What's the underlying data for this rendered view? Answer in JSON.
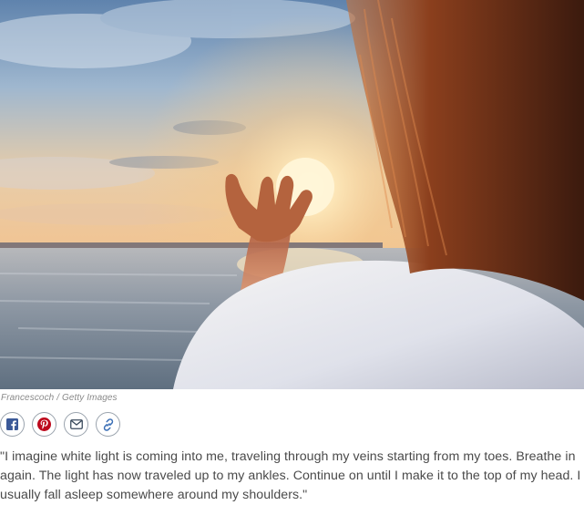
{
  "photo": {
    "credit": "Francescoch / Getty Images",
    "colors": {
      "sky_top": "#5f83ad",
      "sky_glow": "#f6d7a7",
      "sun": "#fff3cf",
      "sea": "#7d8b9c",
      "hair": "#5a2a16",
      "shirt": "#e9eaf0"
    }
  },
  "share": {
    "buttons": [
      {
        "icon": "facebook-icon"
      },
      {
        "icon": "pinterest-icon"
      },
      {
        "icon": "email-icon"
      },
      {
        "icon": "link-icon"
      }
    ],
    "colors": {
      "facebook": "#3b5998",
      "pinterest": "#bd081c",
      "email": "#3a4a5c",
      "link": "#3b6fb6"
    }
  },
  "article": {
    "quote": "\"I imagine white light is coming into me, traveling through my veins starting from my toes. Breathe in again. The light has now traveled up to my ankles. Continue on until I make it to the top of my head. I usually fall asleep somewhere around my shoulders.\""
  }
}
